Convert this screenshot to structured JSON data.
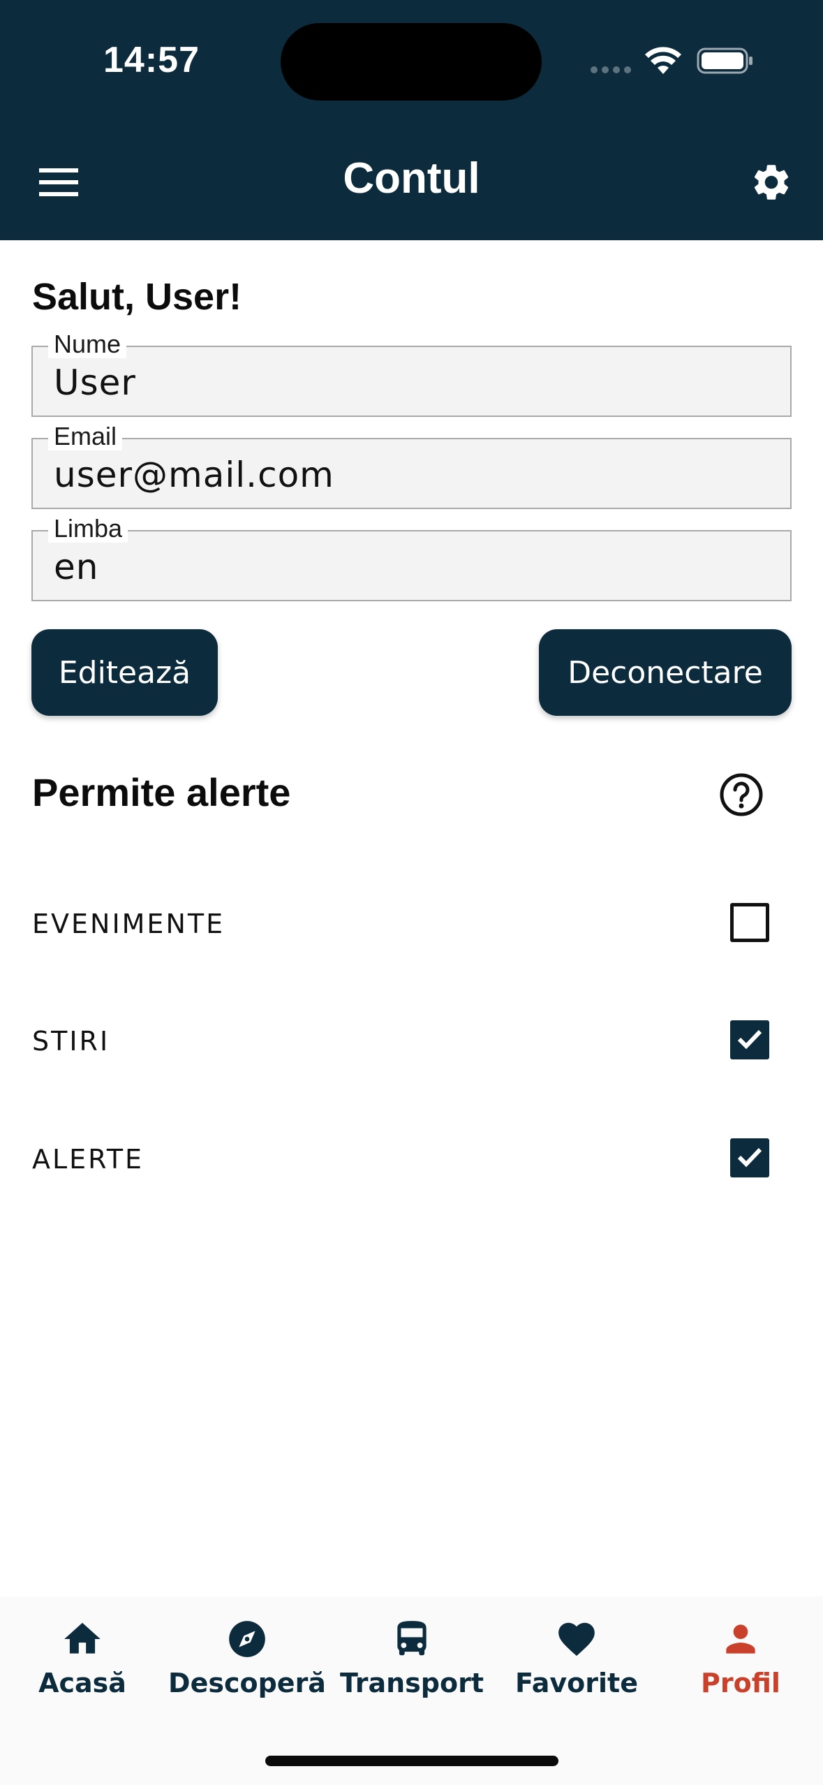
{
  "status_bar": {
    "time": "14:57"
  },
  "header": {
    "title": "Contul"
  },
  "greeting": "Salut, User!",
  "fields": [
    {
      "label": "Nume",
      "value": "User"
    },
    {
      "label": "Email",
      "value": "user@mail.com"
    },
    {
      "label": "Limba",
      "value": "en"
    }
  ],
  "buttons": {
    "edit": "Editează",
    "logout": "Deconectare"
  },
  "alerts": {
    "title": "Permite alerte",
    "items": [
      {
        "label": "EVENIMENTE",
        "checked": false
      },
      {
        "label": "STIRI",
        "checked": true
      },
      {
        "label": "ALERTE",
        "checked": true
      }
    ]
  },
  "nav": {
    "items": [
      {
        "label": "Acasă",
        "icon": "home-icon"
      },
      {
        "label": "Descoperă",
        "icon": "compass-icon"
      },
      {
        "label": "Transport",
        "icon": "bus-icon"
      },
      {
        "label": "Favorite",
        "icon": "heart-icon"
      },
      {
        "label": "Profil",
        "icon": "person-icon",
        "active": true
      }
    ]
  },
  "colors": {
    "primary": "#0c2c3d",
    "active": "#c9412a",
    "field_bg": "#f3f3f3"
  }
}
